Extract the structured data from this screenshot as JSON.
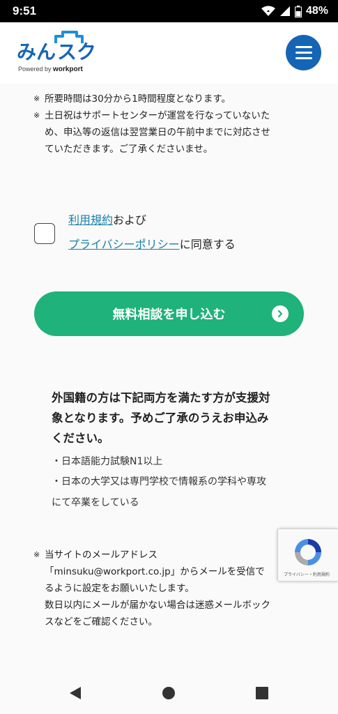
{
  "status_bar": {
    "time": "9:51",
    "battery": "48%",
    "icons": [
      "wifi-icon",
      "signal-icon",
      "battery-icon"
    ]
  },
  "header": {
    "logo_text": "みんスク",
    "powered_prefix": "Powered by ",
    "powered_brand": "workport",
    "menu_icon": "hamburger-menu-icon"
  },
  "notes": {
    "mark": "※",
    "note1": "所要時間は30分から1時間程度となります。",
    "note2_lines": [
      "土日祝はサポートセンターが運営を行なっていないた",
      "め、申込等の返信は翌営業日の午前中までに対応させ",
      "ていただきます。ご了承くださいませ。"
    ]
  },
  "consent": {
    "terms_link": "利用規約",
    "and_text": "および",
    "privacy_link": "プライバシーポリシー",
    "agree_text": "に同意する"
  },
  "submit": {
    "label": "無料相談を申し込む"
  },
  "eligibility": {
    "title_lines": [
      "外国籍の方は下記両方を満たす方が支援対",
      "象となります。予めご了承のうえお申込み",
      "ください。"
    ],
    "item1": "・日本語能力試験N1以上",
    "item2_lines": [
      "・日本の大学又は専門学校で情報系の学科や専攻",
      "にて卒業をしている"
    ]
  },
  "email_note": {
    "mark": "※",
    "lines": [
      "当サイトのメールアドレス",
      "「minsuku@workport.co.jp」からメールを受信で",
      "るように設定をお願いいたします。",
      "数日以内にメールが届かない場合は迷惑メールボック",
      "スなどをご確認ください。"
    ]
  },
  "recaptcha": {
    "text": "プライバシー・利用規約"
  },
  "colors": {
    "brand_blue": "#1565b6",
    "submit_green": "#1fb27a",
    "link": "#1a7fa6"
  }
}
